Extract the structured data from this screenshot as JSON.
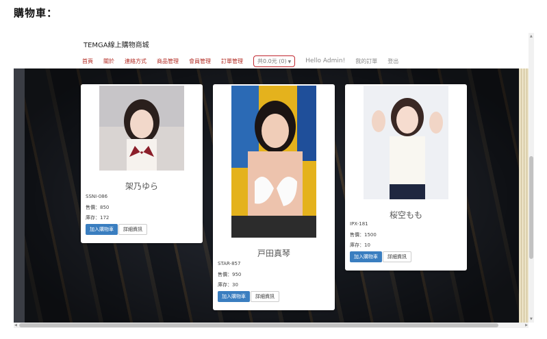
{
  "doc_heading": "購物車：",
  "site": {
    "brand": "TEMGA線上購物商城",
    "nav": [
      "首頁",
      "關於",
      "連絡方式",
      "商品管理",
      "會員管理",
      "訂單管理"
    ],
    "cart": "共0.0元 (0)",
    "greeting": "Hello Admin!",
    "my_orders": "我的訂單",
    "logout": "登出"
  },
  "products": [
    {
      "name": "架乃ゆら",
      "code": "SSNI-086",
      "price": "售價：850",
      "stock": "庫存：172",
      "add": "加入購物車",
      "detail": "詳細資訊"
    },
    {
      "name": "戸田真琴",
      "code": "STAR-857",
      "price": "售價：950",
      "stock": "庫存：30",
      "add": "加入購物車",
      "detail": "詳細資訊"
    },
    {
      "name": "桜空もも",
      "code": "IPX-181",
      "price": "售價：1500",
      "stock": "庫存：10",
      "add": "加入購物車",
      "detail": "詳細資訊"
    }
  ],
  "colors": {
    "accent": "#b22a22",
    "primary_button": "#3a7ec0",
    "cart_border": "#c0262e"
  }
}
